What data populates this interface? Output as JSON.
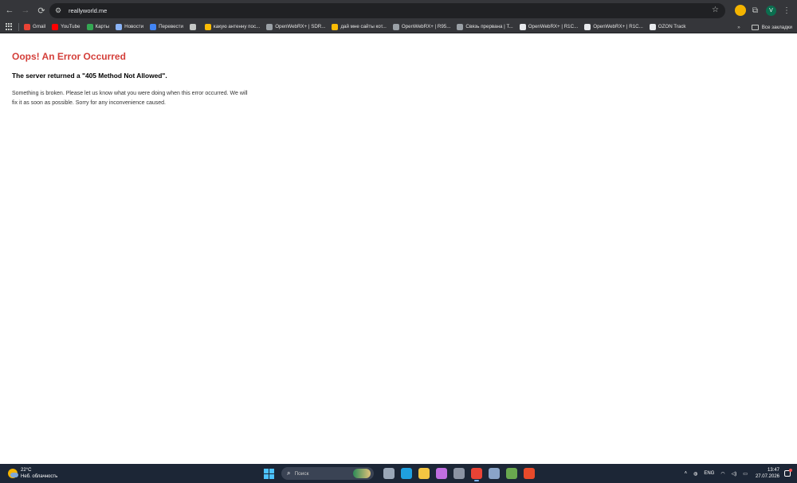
{
  "browser": {
    "url": "reallyworld.me",
    "profile_initial": "V"
  },
  "bookmarks": [
    {
      "label": "Gmail",
      "icon": "gmail-icon",
      "color": "#ea4335"
    },
    {
      "label": "YouTube",
      "icon": "youtube-icon",
      "color": "#ff0000"
    },
    {
      "label": "Карты",
      "icon": "maps-icon",
      "color": "#34a853"
    },
    {
      "label": "Новости",
      "icon": "news-icon",
      "color": "#8ab4f8"
    },
    {
      "label": "Перевести",
      "icon": "translate-icon",
      "color": "#4285f4"
    },
    {
      "label": "",
      "icon": "globe-icon",
      "color": "#c4c7c5"
    },
    {
      "label": "какую антенну пос...",
      "icon": "google-icon",
      "color": "#fbbc05"
    },
    {
      "label": "OpenWebRX+ | SDR...",
      "icon": "openwebrx-icon",
      "color": "#9aa0a6"
    },
    {
      "label": "дай мне сайты кот...",
      "icon": "google-icon",
      "color": "#fbbc05"
    },
    {
      "label": "OpenWebRX+ | R95...",
      "icon": "openwebrx-icon",
      "color": "#9aa0a6"
    },
    {
      "label": "Связь прервана | T...",
      "icon": "openwebrx-icon",
      "color": "#9aa0a6"
    },
    {
      "label": "OpenWebRX+ | R1C...",
      "icon": "openwebrx-icon",
      "color": "#e8eaed"
    },
    {
      "label": "OpenWebRX+ | R1C...",
      "icon": "openwebrx-icon",
      "color": "#e8eaed"
    },
    {
      "label": "OZON Track",
      "icon": "ozon-icon",
      "color": "#e8eaed"
    }
  ],
  "bookmarks_overflow": "»",
  "all_bookmarks_label": "Все закладки",
  "page": {
    "title": "Oops! An Error Occurred",
    "subtitle": "The server returned a \"405 Method Not Allowed\".",
    "message": "Something is broken. Please let us know what you were doing when this error occurred. We will fix it as soon as possible. Sorry for any inconvenience caused."
  },
  "taskbar": {
    "weather_temp": "22°C",
    "weather_desc": "Неб. облачность",
    "search_placeholder": "Поиск",
    "apps": [
      {
        "name": "task-view-icon",
        "color": "#9aa7b8"
      },
      {
        "name": "edge-icon",
        "color": "#1fa0e0"
      },
      {
        "name": "file-explorer-icon",
        "color": "#f4c542"
      },
      {
        "name": "visual-studio-icon",
        "color": "#c06ee0"
      },
      {
        "name": "calendar-app-icon",
        "color": "#8b93a3"
      },
      {
        "name": "chrome-icon",
        "color": "#ea4335",
        "active": true
      },
      {
        "name": "settings-icon",
        "color": "#8aa4c8"
      },
      {
        "name": "app-icon",
        "color": "#6aa84f"
      },
      {
        "name": "app-av-icon",
        "color": "#e84a2a"
      }
    ],
    "lang": "ENG",
    "time": "13:47",
    "date": "27.07.2026"
  }
}
